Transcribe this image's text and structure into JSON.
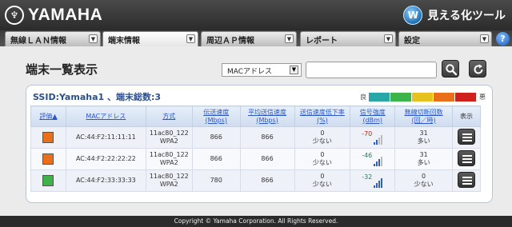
{
  "header": {
    "brand": "YAMAHA",
    "tool_name": "見える化ツール",
    "tool_icon": "wireless-globe-icon"
  },
  "tabs": [
    {
      "label": "無線ＬＡＮ情報",
      "active": false
    },
    {
      "label": "端末情報",
      "active": true
    },
    {
      "label": "周辺ＡＰ情報",
      "active": false
    },
    {
      "label": "レポート",
      "active": false
    },
    {
      "label": "設定",
      "active": false
    }
  ],
  "help_label": "?",
  "page_title": "端末一覧表示",
  "search": {
    "field_selected": "MACアドレス",
    "value": "",
    "search_icon": "magnifier-icon",
    "refresh_icon": "refresh-icon"
  },
  "panel": {
    "title": "SSID:Yamaha1 、端末総数:3",
    "legend": {
      "good": "良",
      "bad": "悪",
      "colors": [
        "#2aa6a6",
        "#3db34a",
        "#e8c21c",
        "#e8701c",
        "#d0201c"
      ]
    },
    "columns": [
      "評価▲",
      "MACアドレス",
      "方式",
      "伝送速度\n(Mbps)",
      "平均送信速度\n(Mbps)",
      "送信速度低下率\n(%)",
      "信号強度\n(dBm)",
      "無線切断回数\n(回／時)",
      "表示"
    ],
    "rows": [
      {
        "rating_color": "#e8701c",
        "mac": "AC:44:F2:11:11:11",
        "mode": "11ac80_122\nWPA2",
        "rate": "866",
        "avg": "866",
        "drop": "0",
        "drop_label": "少ない",
        "signal": "-70",
        "signal_bars": 2,
        "disc": "31",
        "disc_label": "多い",
        "disc_level": "high"
      },
      {
        "rating_color": "#e8701c",
        "mac": "AC:44:F2:22:22:22",
        "mode": "11ac80_122\nWPA2",
        "rate": "866",
        "avg": "866",
        "drop": "0",
        "drop_label": "少ない",
        "signal": "-46",
        "signal_bars": 3,
        "disc": "31",
        "disc_label": "多い",
        "disc_level": "high"
      },
      {
        "rating_color": "#3db34a",
        "mac": "AC:44:F2:33:33:33",
        "mode": "11ac80_122\nWPA2",
        "rate": "780",
        "avg": "866",
        "drop": "0",
        "drop_label": "少ない",
        "signal": "-32",
        "signal_bars": 4,
        "disc": "0",
        "disc_label": "少ない",
        "disc_level": "low"
      }
    ]
  },
  "footer": {
    "copyright": "Copyright © Yamaha Corporation. All Rights Reserved."
  }
}
